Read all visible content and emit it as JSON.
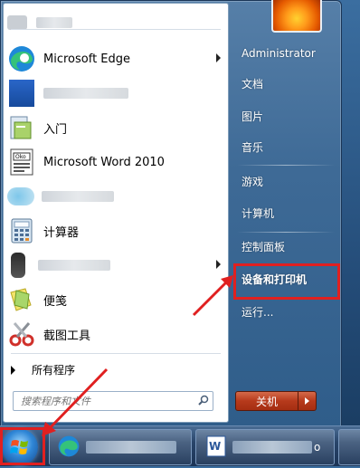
{
  "left_pane": {
    "items": [
      {
        "label": "",
        "icon": "app-icon"
      },
      {
        "label": "Microsoft Edge",
        "icon": "edge-icon",
        "has_submenu": true
      },
      {
        "label": "",
        "icon": "app-icon"
      },
      {
        "label": "入门",
        "icon": "getting-started-icon"
      },
      {
        "label": "Microsoft Word 2010",
        "icon": "word-icon"
      },
      {
        "label": "",
        "icon": "app-icon"
      },
      {
        "label": "计算器",
        "icon": "calculator-icon"
      },
      {
        "label": "",
        "icon": "app-icon",
        "has_submenu": true
      },
      {
        "label": "便笺",
        "icon": "sticky-notes-icon"
      },
      {
        "label": "截图工具",
        "icon": "snipping-tool-icon"
      }
    ],
    "all_programs": "所有程序",
    "search_placeholder": "搜索程序和文件"
  },
  "right_pane": {
    "items": [
      {
        "label": "Administrator"
      },
      {
        "label": "文档"
      },
      {
        "label": "图片"
      },
      {
        "label": "音乐"
      },
      {
        "label": "游戏"
      },
      {
        "label": "计算机"
      },
      {
        "label": "控制面板",
        "has_submenu": true
      },
      {
        "label": "设备和打印机"
      },
      {
        "label": "运行..."
      }
    ],
    "shutdown_label": "关机"
  },
  "taskbar": {
    "tasks": [
      {
        "label": "",
        "icon": "edge-icon"
      },
      {
        "label": "",
        "icon": "word-icon",
        "suffix": "o"
      }
    ]
  },
  "colors": {
    "highlight": "#e02020",
    "menu_blue": "#3e6a96"
  }
}
